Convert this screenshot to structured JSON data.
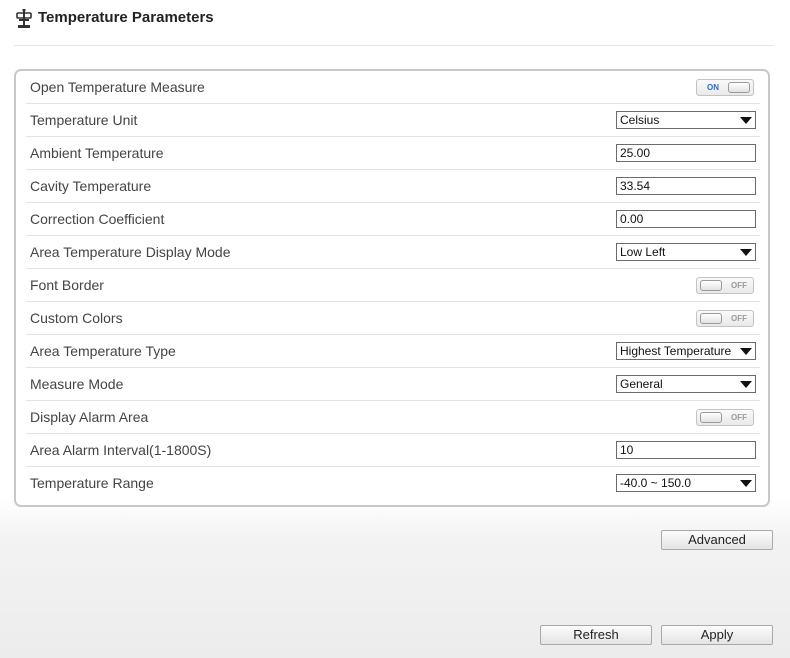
{
  "page": {
    "title": "Temperature Parameters",
    "title_icon": "temperature-gauge-icon"
  },
  "rows": [
    {
      "label": "Open Temperature Measure",
      "control": "toggle",
      "state": "ON"
    },
    {
      "label": "Temperature Unit",
      "control": "select",
      "value": "Celsius"
    },
    {
      "label": "Ambient Temperature",
      "control": "input",
      "value": "25.00"
    },
    {
      "label": "Cavity Temperature",
      "control": "input",
      "value": "33.54"
    },
    {
      "label": "Correction Coefficient",
      "control": "input",
      "value": "0.00"
    },
    {
      "label": "Area Temperature Display Mode",
      "control": "select",
      "value": "Low Left"
    },
    {
      "label": "Font Border",
      "control": "toggle",
      "state": "OFF"
    },
    {
      "label": "Custom Colors",
      "control": "toggle",
      "state": "OFF"
    },
    {
      "label": "Area Temperature Type",
      "control": "select",
      "value": "Highest Temperature"
    },
    {
      "label": "Measure Mode",
      "control": "select",
      "value": "General"
    },
    {
      "label": "Display Alarm Area",
      "control": "toggle",
      "state": "OFF"
    },
    {
      "label": "Area Alarm Interval(1-1800S)",
      "control": "input",
      "value": "10"
    },
    {
      "label": "Temperature Range",
      "control": "select",
      "value": "-40.0 ~ 150.0"
    }
  ],
  "buttons": {
    "advanced": "Advanced",
    "refresh": "Refresh",
    "apply": "Apply"
  },
  "colors": {
    "toggle_on_text": "#2a6cc7",
    "toggle_off_text": "#9a9a9a",
    "panel_border": "#c8c8c8"
  }
}
